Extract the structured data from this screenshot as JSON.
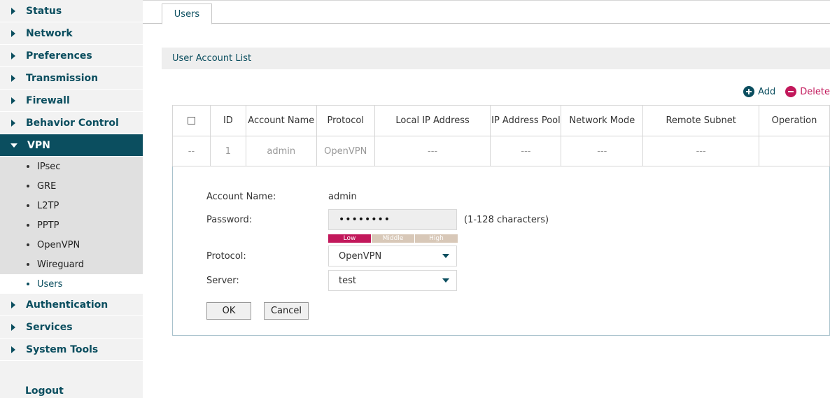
{
  "sidebar": {
    "items_top": [
      "Status",
      "Network",
      "Preferences",
      "Transmission",
      "Firewall",
      "Behavior Control"
    ],
    "active": "VPN",
    "sub_items": [
      "IPsec",
      "GRE",
      "L2TP",
      "PPTP",
      "OpenVPN",
      "Wireguard",
      "Users"
    ],
    "items_bottom": [
      "Authentication",
      "Services",
      "System Tools"
    ],
    "logout": "Logout"
  },
  "tab": {
    "label": "Users"
  },
  "section": {
    "title": "User Account List"
  },
  "actions": {
    "add": "Add",
    "delete": "Delete"
  },
  "table": {
    "headers": [
      "ID",
      "Account Name",
      "Protocol",
      "Local IP Address",
      "IP Address Pool",
      "Network Mode",
      "Remote Subnet",
      "Operation"
    ],
    "row": [
      "--",
      "1",
      "admin",
      "OpenVPN",
      "---",
      "---",
      "---",
      "---",
      ""
    ]
  },
  "form": {
    "account_label": "Account Name:",
    "account_value": "admin",
    "password_label": "Password:",
    "password_value": "••••••••",
    "password_hint": "(1-128 characters)",
    "strength": [
      "Low",
      "Middle",
      "High"
    ],
    "protocol_label": "Protocol:",
    "protocol_value": "OpenVPN",
    "server_label": "Server:",
    "server_value": "test",
    "ok": "OK",
    "cancel": "Cancel"
  },
  "colors": {
    "accent": "#0b4e5f",
    "danger": "#c2185b"
  }
}
